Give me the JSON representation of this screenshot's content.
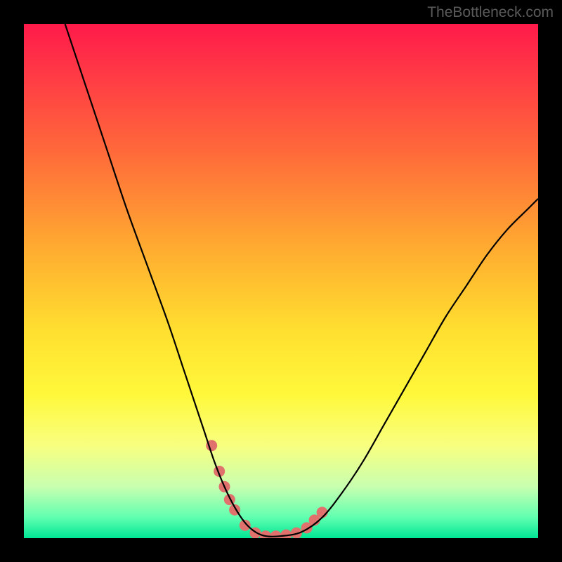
{
  "watermark": "TheBottleneck.com",
  "chart_data": {
    "type": "line",
    "title": "",
    "xlabel": "",
    "ylabel": "",
    "xlim": [
      0,
      100
    ],
    "ylim": [
      0,
      100
    ],
    "background_gradient_stops": [
      {
        "pct": 0,
        "color": "#ff1a4a"
      },
      {
        "pct": 10,
        "color": "#ff3a45"
      },
      {
        "pct": 25,
        "color": "#ff6a3a"
      },
      {
        "pct": 45,
        "color": "#ffb030"
      },
      {
        "pct": 60,
        "color": "#ffe030"
      },
      {
        "pct": 72,
        "color": "#fff83a"
      },
      {
        "pct": 82,
        "color": "#f8ff80"
      },
      {
        "pct": 90,
        "color": "#c8ffb0"
      },
      {
        "pct": 96,
        "color": "#60ffb0"
      },
      {
        "pct": 100,
        "color": "#00e695"
      }
    ],
    "series": [
      {
        "name": "bottleneck-curve",
        "color": "#000000",
        "x": [
          8,
          12,
          16,
          20,
          24,
          28,
          31,
          33,
          35,
          37,
          39,
          41,
          43,
          45,
          47,
          50,
          54,
          58,
          62,
          66,
          70,
          74,
          78,
          82,
          86,
          90,
          94,
          98,
          100
        ],
        "y": [
          100,
          88,
          76,
          64,
          53,
          42,
          33,
          27,
          21,
          15,
          10,
          6,
          3,
          1.2,
          0.4,
          0.4,
          1.2,
          4,
          9,
          15,
          22,
          29,
          36,
          43,
          49,
          55,
          60,
          64,
          66
        ]
      }
    ],
    "marker_points": {
      "name": "highlighted-range",
      "color": "#e0716c",
      "radius_px": 8,
      "x": [
        36.5,
        38,
        39,
        40,
        41,
        43,
        45,
        47,
        49,
        51,
        53,
        55,
        56.5,
        58
      ],
      "y": [
        18,
        13,
        10,
        7.5,
        5.5,
        2.5,
        1.0,
        0.4,
        0.4,
        0.6,
        1.0,
        2.0,
        3.5,
        5.0
      ]
    }
  }
}
